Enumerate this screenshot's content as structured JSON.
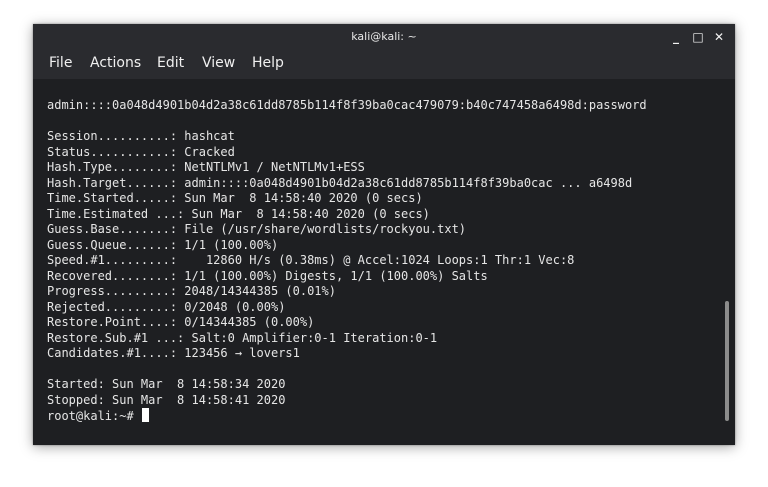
{
  "window": {
    "title": "kali@kali: ~",
    "controls": {
      "minimize": "_",
      "maximize": "□",
      "close": "✕"
    }
  },
  "menu": [
    "File",
    "Actions",
    "Edit",
    "View",
    "Help"
  ],
  "terminal": {
    "lines": [
      "admin::::0a048d4901b04d2a38c61dd8785b114f8f39ba0cac479079:b40c747458a6498d:password",
      "",
      "Session..........: hashcat",
      "Status...........: Cracked",
      "Hash.Type........: NetNTLMv1 / NetNTLMv1+ESS",
      "Hash.Target......: admin::::0a048d4901b04d2a38c61dd8785b114f8f39ba0cac ... a6498d",
      "Time.Started.....: Sun Mar  8 14:58:40 2020 (0 secs)",
      "Time.Estimated ...: Sun Mar  8 14:58:40 2020 (0 secs)",
      "Guess.Base.......: File (/usr/share/wordlists/rockyou.txt)",
      "Guess.Queue......: 1/1 (100.00%)",
      "Speed.#1.........:    12860 H/s (0.38ms) @ Accel:1024 Loops:1 Thr:1 Vec:8",
      "Recovered........: 1/1 (100.00%) Digests, 1/1 (100.00%) Salts",
      "Progress.........: 2048/14344385 (0.01%)",
      "Rejected.........: 0/2048 (0.00%)",
      "Restore.Point....: 0/14344385 (0.00%)",
      "Restore.Sub.#1 ...: Salt:0 Amplifier:0-1 Iteration:0-1",
      "Candidates.#1....: 123456 → lovers1",
      "",
      "Started: Sun Mar  8 14:58:34 2020",
      "Stopped: Sun Mar  8 14:58:41 2020"
    ],
    "prompt": "root@kali:~# "
  },
  "colors": {
    "background": "#1e1f22",
    "titlebar": "#2a2b2f",
    "text": "#e6e6e6"
  }
}
